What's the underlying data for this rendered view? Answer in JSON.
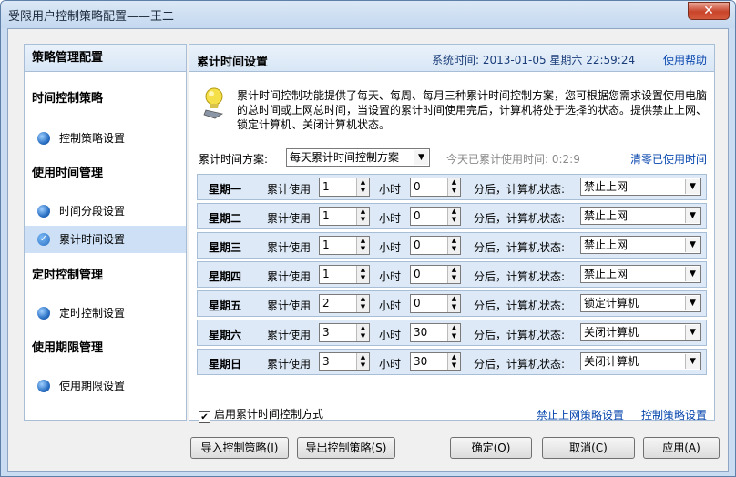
{
  "window": {
    "title": "受限用户控制策略配置——王二",
    "close": "✕"
  },
  "left": {
    "header": "策略管理配置",
    "sections": [
      {
        "title": "时间控制策略",
        "items": [
          "控制策略设置"
        ]
      },
      {
        "title": "使用时间管理",
        "items": [
          "时间分段设置",
          "累计时间设置"
        ]
      },
      {
        "title": "定时控制管理",
        "items": [
          "定时控制设置"
        ]
      },
      {
        "title": "使用期限管理",
        "items": [
          "使用期限设置"
        ]
      }
    ]
  },
  "right": {
    "title": "累计时间设置",
    "systime": "系统时间: 2013-01-05  星期六  22:59:24",
    "help": "使用帮助",
    "desc": "累计时间控制功能提供了每天、每周、每月三种累计时间控制方案，您可根据您需求设置使用电脑的总时间或上网总时间，当设置的累计时间使用完后，计算机将处于选择的状态。提供禁止上网、锁定计算机、关闭计算机状态。",
    "plan_label": "累计时间方案:",
    "plan_value": "每天累计时间控制方案",
    "used": "今天已累计使用时间: 0:2:9",
    "clear": "清零已使用时间",
    "lbl_use": "累计使用",
    "lbl_hour": "小时",
    "lbl_after": "分后，计算机状态:",
    "rows": [
      {
        "day": "星期一",
        "h": "1",
        "m": "0",
        "state": "禁止上网"
      },
      {
        "day": "星期二",
        "h": "1",
        "m": "0",
        "state": "禁止上网"
      },
      {
        "day": "星期三",
        "h": "1",
        "m": "0",
        "state": "禁止上网"
      },
      {
        "day": "星期四",
        "h": "1",
        "m": "0",
        "state": "禁止上网"
      },
      {
        "day": "星期五",
        "h": "2",
        "m": "0",
        "state": "锁定计算机"
      },
      {
        "day": "星期六",
        "h": "3",
        "m": "30",
        "state": "关闭计算机"
      },
      {
        "day": "星期日",
        "h": "3",
        "m": "30",
        "state": "关闭计算机"
      }
    ],
    "enable": "启用累计时间控制方式",
    "link1": "禁止上网策略设置",
    "link2": "控制策略设置"
  },
  "buttons": {
    "import": "导入控制策略(I)",
    "export": "导出控制策略(S)",
    "ok": "确定(O)",
    "cancel": "取消(C)",
    "apply": "应用(A)"
  }
}
